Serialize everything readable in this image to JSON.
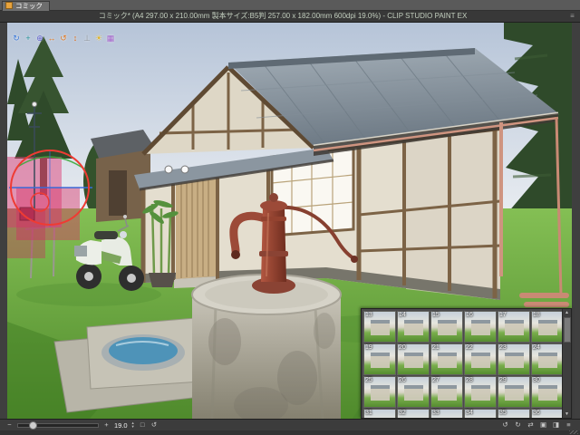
{
  "window": {
    "title": "コミック* (A4 297.00 x 210.00mm 製本サイズ:B5判 257.00 x 182.00mm 600dpi 19.0%) - CLIP STUDIO PAINT EX",
    "menu_glyph": "≡"
  },
  "document_tab": {
    "label": "コミック"
  },
  "toolbar3d": {
    "icons": [
      {
        "name": "camera-rotate-icon",
        "glyph": "↻"
      },
      {
        "name": "camera-pan-icon",
        "glyph": "+"
      },
      {
        "name": "camera-zoom-icon",
        "glyph": "⊕"
      },
      {
        "name": "object-move-icon",
        "glyph": "↔"
      },
      {
        "name": "object-rotate-icon",
        "glyph": "↺"
      },
      {
        "name": "object-lift-icon",
        "glyph": "↕"
      },
      {
        "name": "snap-ground-icon",
        "glyph": "⊥"
      },
      {
        "name": "light-source-icon",
        "glyph": "☀"
      },
      {
        "name": "camera-angle-list-icon",
        "glyph": "▦"
      }
    ]
  },
  "preset_panel": {
    "thumbs": [
      "13",
      "14",
      "15",
      "16",
      "17",
      "18",
      "19",
      "20",
      "21",
      "22",
      "23",
      "24",
      "25",
      "26",
      "27",
      "28",
      "29",
      "30",
      "31",
      "32",
      "33",
      "34",
      "35",
      "36"
    ],
    "scroll_up_glyph": "▲",
    "scroll_down_glyph": "▼"
  },
  "statusbar": {
    "zoom_out_glyph": "−",
    "zoom_in_glyph": "+",
    "zoom_value": "19.0",
    "fit_glyph": "□",
    "reset_glyph": "↺",
    "spin_up_glyph": "▲",
    "spin_down_glyph": "▼",
    "right_icons": [
      {
        "name": "rotate-left-icon",
        "glyph": "↺"
      },
      {
        "name": "rotate-right-icon",
        "glyph": "↻"
      },
      {
        "name": "flip-horizontal-icon",
        "glyph": "⇄"
      },
      {
        "name": "navigator-icon",
        "glyph": "▣"
      },
      {
        "name": "subview-icon",
        "glyph": "◨"
      },
      {
        "name": "options-icon",
        "glyph": "≡"
      }
    ]
  },
  "scene": {
    "colors": {
      "sky_top": "#b6c4d8",
      "sky_bottom": "#f1f3f5",
      "grass": "#6fae3e",
      "tree_green": "#2f4a2a",
      "roof_gray": "#8d98a2",
      "wall_plaster": "#e4decf",
      "wood_beam": "#7c6346",
      "door_tan": "#c8ae84",
      "shoji_white": "#faf8f2",
      "well_concrete": "#b0ac9f",
      "pump_rust": "#9c4a38",
      "water_blue": "#4e93b8",
      "copper_pipe": "#cf9480",
      "gizmo_red": "#ef3b33",
      "gizmo_pink": "#dd4077"
    }
  }
}
